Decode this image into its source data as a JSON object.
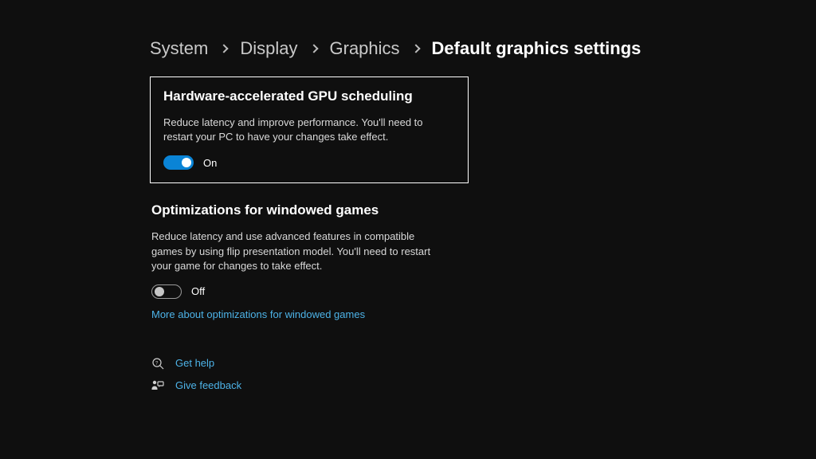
{
  "breadcrumb": {
    "items": [
      {
        "label": "System"
      },
      {
        "label": "Display"
      },
      {
        "label": "Graphics"
      },
      {
        "label": "Default graphics settings"
      }
    ]
  },
  "sections": {
    "gpu": {
      "title": "Hardware-accelerated GPU scheduling",
      "desc": "Reduce latency and improve performance. You'll need to restart your PC to have your changes take effect.",
      "toggle_state": "On"
    },
    "windowed": {
      "title": "Optimizations for windowed games",
      "desc": "Reduce latency and use advanced features in compatible games by using flip presentation model. You'll need to restart your game for changes to take effect.",
      "toggle_state": "Off",
      "more_link": "More about optimizations for windowed games"
    }
  },
  "footer": {
    "help": "Get help",
    "feedback": "Give feedback"
  }
}
